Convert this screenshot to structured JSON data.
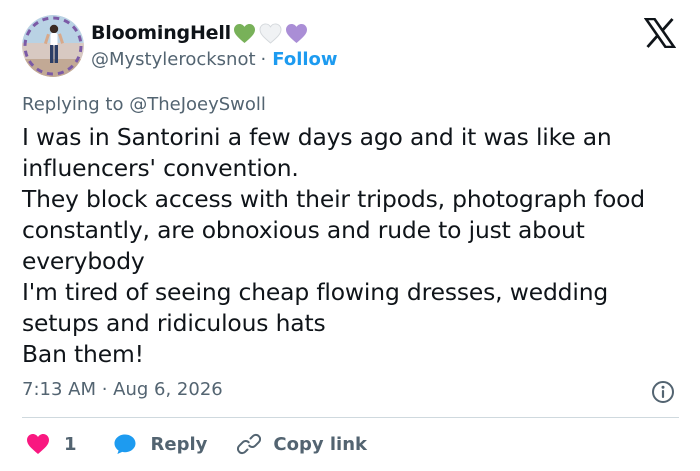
{
  "author": {
    "display_name": "BloomingHell",
    "handle": "@Mystylerocksnot",
    "separator": "·",
    "follow_label": "Follow",
    "name_emojis": [
      "green-heart",
      "white-heart",
      "purple-heart"
    ],
    "avatar": "avatar-photo"
  },
  "reply_context": {
    "prefix": "Replying to",
    "mention": "@TheJoeySwoll"
  },
  "tweet": {
    "text": "I was in Santorini a few days ago and it was like an influencers' convention.\nThey block access with their tripods, photograph food constantly, are obnoxious and rude to just about everybody\nI'm tired of seeing cheap flowing dresses, wedding setups and ridiculous hats\nBan them!",
    "timestamp": "7:13 AM · Aug 6, 2026"
  },
  "actions": {
    "like_count": "1",
    "reply_label": "Reply",
    "copy_link_label": "Copy link"
  },
  "icons": {
    "logo": "x-logo-icon",
    "info": "info-icon",
    "like": "heart-icon",
    "reply": "speech-bubble-icon",
    "copy": "link-icon"
  },
  "colors": {
    "text": "#0f1419",
    "secondary": "#536471",
    "accent": "#1d9bf0",
    "like": "#f91880",
    "divider": "#cfd9de"
  }
}
